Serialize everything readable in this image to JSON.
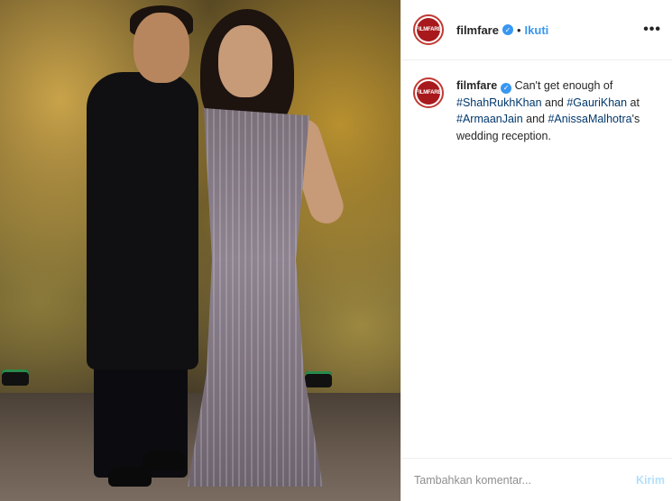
{
  "post": {
    "image_alt": "Shah Rukh Khan and Gauri Khan at a wedding reception",
    "colors": {
      "accent": "#3897f0",
      "brand": "#a8191d",
      "hashtag": "#00376b"
    }
  },
  "header": {
    "avatar_text": "FILMFARE",
    "username": "filmfare",
    "verified_icon": "verified-badge-icon",
    "separator": "•",
    "follow_label": "Ikuti",
    "more_icon": "•••"
  },
  "caption": {
    "avatar_text": "FILMFARE",
    "username": "filmfare",
    "text_1": " Can't get enough of ",
    "tag_1": "#ShahRukhKhan",
    "text_2": " and ",
    "tag_2": "#GauriKhan",
    "text_3": " at ",
    "tag_3": "#ArmaanJain",
    "text_4": " and ",
    "tag_4": "#AnissaMalhotra",
    "text_5": "'s wedding reception."
  },
  "comment": {
    "placeholder": "Tambahkan komentar...",
    "send_label": "Kirim"
  }
}
